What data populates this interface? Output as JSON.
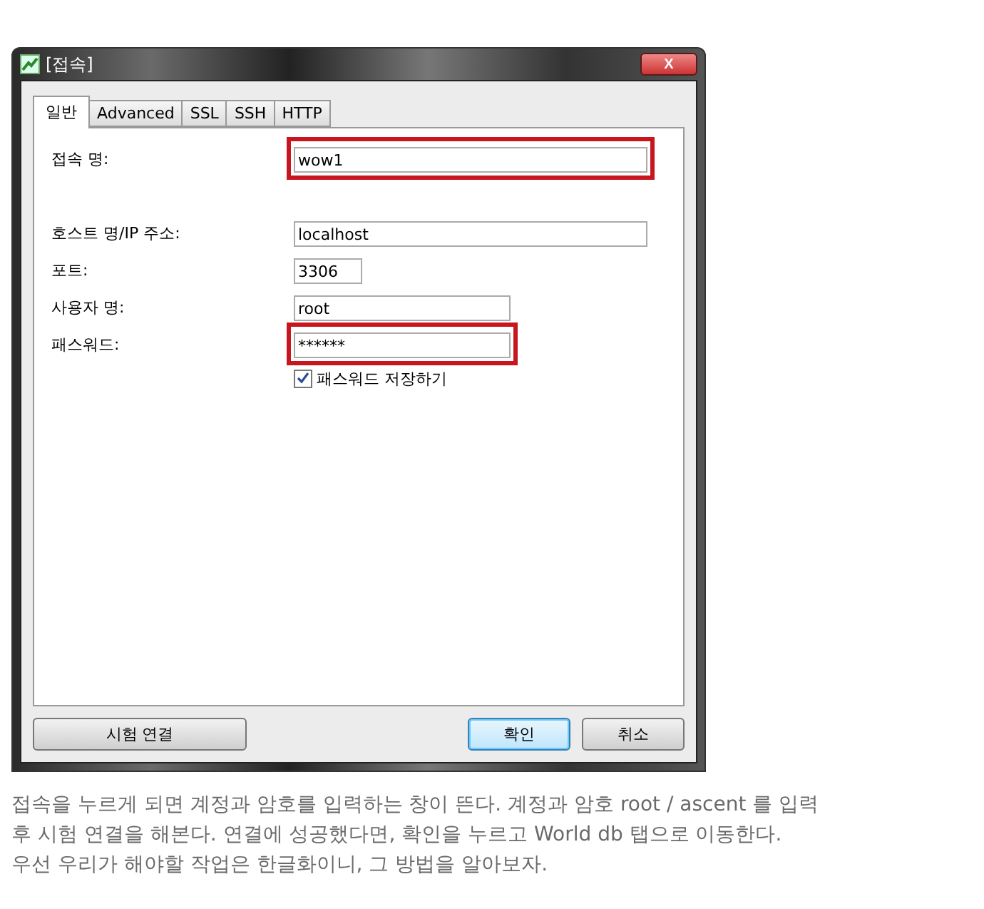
{
  "window": {
    "title": "[접속]",
    "close": "X"
  },
  "tabs": [
    {
      "label": "일반",
      "selected": true
    },
    {
      "label": "Advanced",
      "selected": false
    },
    {
      "label": "SSL",
      "selected": false
    },
    {
      "label": "SSH",
      "selected": false
    },
    {
      "label": "HTTP",
      "selected": false
    }
  ],
  "fields": [
    {
      "label": "접속 명:",
      "value": "wow1",
      "highlighted": true
    },
    {
      "label": "호스트 명/IP 주소:",
      "value": "localhost",
      "highlighted": false
    },
    {
      "label": "포트:",
      "value": "3306",
      "highlighted": false
    },
    {
      "label": "사용자 명:",
      "value": "root",
      "highlighted": false
    },
    {
      "label": "패스워드:",
      "value": "******",
      "highlighted": true
    }
  ],
  "save_password": {
    "label": "패스워드 저장하기",
    "checked": true
  },
  "buttons": [
    {
      "label": "시험 연결",
      "kind": "test",
      "focused": false
    },
    {
      "label": "확인",
      "kind": "ok",
      "focused": true
    },
    {
      "label": "취소",
      "kind": "cancel",
      "focused": false
    }
  ],
  "caption": [
    "접속을 누르게 되면 계정과 암호를 입력하는 창이 뜬다. 계정과 암호 root / ascent 를 입력",
    "후 시험 연결을 해본다. 연결에 성공했다면, 확인을 누르고 World db 탭으로 이동한다.",
    "우선 우리가 해야할 작업은 한글화이니, 그 방법을 알아보자."
  ]
}
